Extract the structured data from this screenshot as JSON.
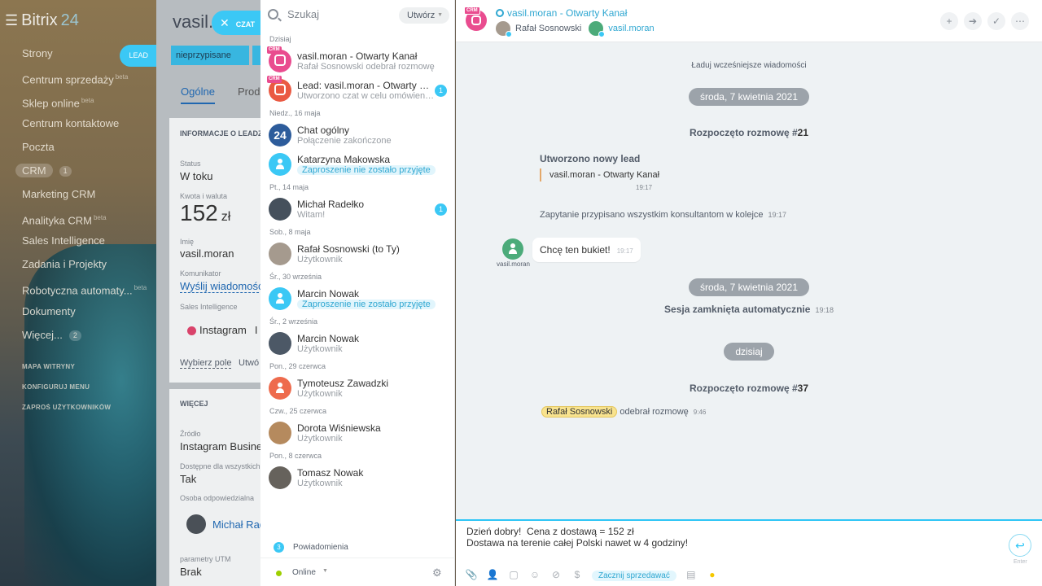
{
  "brand": {
    "name": "Bitrix",
    "suffix": "24"
  },
  "left_menu": {
    "items": [
      {
        "label": "Strony",
        "sup": "",
        "counter": ""
      },
      {
        "label": "Centrum sprzedaży",
        "sup": "beta",
        "counter": ""
      },
      {
        "label": "Sklep online",
        "sup": "beta",
        "counter": ""
      },
      {
        "label": "Centrum kontaktowe",
        "sup": "",
        "counter": ""
      },
      {
        "label": "Poczta",
        "sup": "",
        "counter": ""
      },
      {
        "label": "CRM",
        "sup": "",
        "counter": "1"
      },
      {
        "label": "Marketing CRM",
        "sup": "",
        "counter": ""
      },
      {
        "label": "Analityka CRM",
        "sup": "beta",
        "counter": ""
      },
      {
        "label": "Sales Intelligence",
        "sup": "",
        "counter": ""
      },
      {
        "label": "Zadania i Projekty",
        "sup": "",
        "counter": ""
      },
      {
        "label": "Robotyczna automaty...",
        "sup": "beta",
        "counter": ""
      },
      {
        "label": "Dokumenty",
        "sup": "",
        "counter": ""
      },
      {
        "label": "Więcej...",
        "sup": "",
        "counter": "2"
      }
    ],
    "links": [
      "MAPA WITRYNY",
      "KONFIGURUJ MENU",
      "ZAPROŚ UŻYTKOWNIKÓW"
    ]
  },
  "lead_panel": {
    "title": "vasil.m",
    "tag": "LEAD",
    "stage": "nieprzypisane",
    "tabs": [
      "Ogólne",
      "Produ"
    ],
    "section1": "INFORMACJE O LEADZIE",
    "status_label": "Status",
    "status_value": "W toku",
    "amount_label": "Kwota i waluta",
    "amount_value": "152",
    "amount_currency": "zł",
    "name_label": "Imię",
    "name_value": "vasil.moran",
    "comm_label": "Komunikator",
    "comm_value": "Wyślij wiadomość",
    "si_label": "Sales Intelligence",
    "si_value": "Instagram",
    "si_value2": "I",
    "choose_field": "Wybierz pole",
    "create_field": "Utwó",
    "section2": "WIĘCEJ",
    "source_label": "Źródło",
    "source_value": "Instagram Business",
    "avail_label": "Dostępne dla wszystkich",
    "avail_value": "Tak",
    "resp_label": "Osoba odpowiedzialna",
    "resp_value": "Michał Rad",
    "utm_label": "parametry UTM",
    "utm_value": "Brak"
  },
  "close_chat": {
    "label": "CZAT"
  },
  "recent": {
    "search_placeholder": "Szukaj",
    "create_label": "Utwórz",
    "groups": [
      {
        "date": "Dzisiaj",
        "items": [
          {
            "name": "vasil.moran - Otwarty Kanał",
            "sub": "Rafał Sosnowski odebrał rozmowę",
            "counter": "",
            "pill": false,
            "avatar": "crm-pink"
          },
          {
            "name": "Lead: vasil.moran - Otwarty Kanał",
            "sub": "Utworzono czat w celu omówienia...",
            "counter": "1",
            "pill": false,
            "avatar": "crm-red"
          }
        ]
      },
      {
        "date": "Niedz., 16 maja",
        "items": [
          {
            "name": "Chat ogólny",
            "sub": "Połączenie zakończone",
            "counter": "",
            "pill": false,
            "avatar": "b24"
          },
          {
            "name": "Katarzyna Makowska",
            "sub": "Zaproszenie nie zostało przyjęte",
            "counter": "",
            "pill": true,
            "avatar": "blue-ol"
          }
        ]
      },
      {
        "date": "Pt., 14 maja",
        "items": [
          {
            "name": "Michał Radełko",
            "sub": "Witam!",
            "counter": "1",
            "pill": false,
            "avatar": "photo1"
          }
        ]
      },
      {
        "date": "Sob., 8 maja",
        "items": [
          {
            "name": "Rafał Sosnowski (to Ty)",
            "sub": "Użytkownik",
            "counter": "",
            "pill": false,
            "avatar": "photo2"
          }
        ]
      },
      {
        "date": "Śr., 30 września",
        "items": [
          {
            "name": "Marcin Nowak",
            "sub": "Zaproszenie nie zostało przyjęte",
            "counter": "",
            "pill": true,
            "avatar": "blue-ol"
          }
        ]
      },
      {
        "date": "Śr., 2 września",
        "items": [
          {
            "name": "Marcin Nowak",
            "sub": "Użytkownik",
            "counter": "",
            "pill": false,
            "avatar": "photo3"
          }
        ]
      },
      {
        "date": "Pon., 29 czerwca",
        "items": [
          {
            "name": "Tymoteusz Zawadzki",
            "sub": "Użytkownik",
            "counter": "",
            "pill": false,
            "avatar": "orange"
          }
        ]
      },
      {
        "date": "Czw., 25 czerwca",
        "items": [
          {
            "name": "Dorota Wiśniewska",
            "sub": "Użytkownik",
            "counter": "",
            "pill": false,
            "avatar": "photo4"
          }
        ]
      },
      {
        "date": "Pon., 8 czerwca",
        "items": [
          {
            "name": "Tomasz Nowak",
            "sub": "Użytkownik",
            "counter": "",
            "pill": false,
            "avatar": "photo5"
          }
        ]
      }
    ],
    "notifications": {
      "count": "3",
      "label": "Powiadomienia"
    },
    "status": {
      "label": "Online"
    }
  },
  "chat": {
    "title": "vasil.moran - Otwarty Kanał",
    "user1": "Rafał Sosnowski",
    "user2": "vasil.moran",
    "load_more": "Ładuj wcześniejsze wiadomości",
    "date1": "środa, 7 kwietnia 2021",
    "started1_text": "Rozpoczęto rozmowę #",
    "started1_num": "21",
    "lead_created": "Utworzono nowy lead",
    "lead_quote": "vasil.moran - Otwarty Kanał",
    "lead_time": "19:17",
    "assigned": "Zapytanie przypisano wszystkim konsultantom w kolejce",
    "assigned_time": "19:17",
    "msg_text": "Chcę ten bukiet!",
    "msg_time": "19:17",
    "msg_author": "vasil.moran",
    "date2": "środa, 7 kwietnia 2021",
    "closed": "Sesja zamknięta automatycznie",
    "closed_time": "19:18",
    "date3": "dzisiaj",
    "started2_text": "Rozpoczęto rozmowę #",
    "started2_num": "37",
    "taken_name": "Rafał Sosnowski",
    "taken_text": "odebrał rozmowę",
    "taken_time": "9:46",
    "composer_text": "Dzień dobry!  Cena z dostawą = 152 zł\nDostawa na terenie całej Polski nawet w 4 godziny!",
    "send_label": "Enter",
    "sell_label": "Zacznij sprzedawać"
  },
  "colors": {
    "accent": "#2fc6f6",
    "link": "#2067b0",
    "badge": "#3bc8f5",
    "crm": "#e94c8f"
  }
}
